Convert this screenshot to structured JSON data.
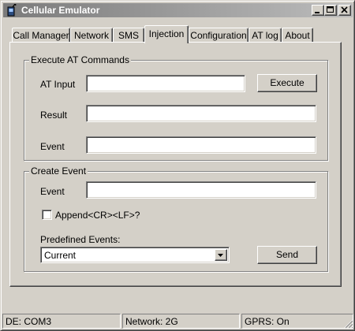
{
  "window": {
    "title": "Cellular Emulator",
    "app_icon": "cellular-app-icon"
  },
  "titlebar_buttons": {
    "minimize": "minimize-icon",
    "maximize": "maximize-icon",
    "close": "close-icon"
  },
  "tabs": [
    {
      "label": "Call Manager",
      "active": false
    },
    {
      "label": "Network",
      "active": false
    },
    {
      "label": "SMS",
      "active": false
    },
    {
      "label": "Injection",
      "active": true
    },
    {
      "label": "Configuration",
      "active": false
    },
    {
      "label": "AT log",
      "active": false
    },
    {
      "label": "About",
      "active": false
    }
  ],
  "execute_group": {
    "title": "Execute AT Commands",
    "at_input_label": "AT Input",
    "at_input_value": "",
    "execute_label": "Execute",
    "result_label": "Result",
    "result_value": "",
    "event_label": "Event",
    "event_value": ""
  },
  "create_group": {
    "title": "Create Event",
    "event_label": "Event",
    "event_value": "",
    "append_label": "Append<CR><LF>?",
    "append_checked": false,
    "predefined_label": "Predefined Events:",
    "predefined_value": "Current",
    "send_label": "Send"
  },
  "statusbar": {
    "port": "DE: COM3",
    "network": "Network: 2G",
    "gprs": "GPRS: On"
  }
}
